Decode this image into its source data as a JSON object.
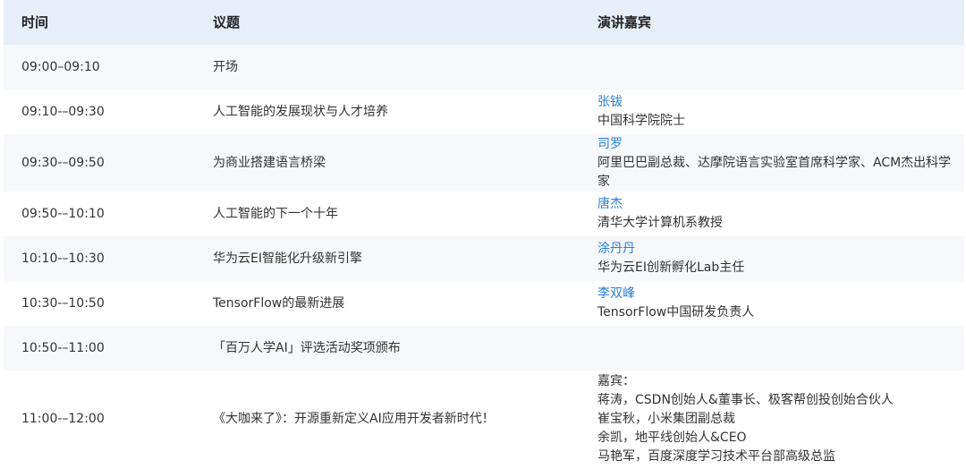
{
  "table": {
    "headers": {
      "time": "时间",
      "topic": "议题",
      "speaker": "演讲嘉宾"
    },
    "rows": [
      {
        "time": "09:00–09:10",
        "topic": "开场",
        "speaker_name": "",
        "speaker_lines": []
      },
      {
        "time": "09:10-–09:30",
        "topic": "人工智能的发展现状与人才培养",
        "speaker_name": "张钹",
        "speaker_lines": [
          "中国科学院院士"
        ]
      },
      {
        "time": "09:30-–09:50",
        "topic": "为商业搭建语言桥梁",
        "speaker_name": "司罗",
        "speaker_lines": [
          "阿里巴巴副总裁、达摩院语言实验室首席科学家、ACM杰出科学",
          "家"
        ]
      },
      {
        "time": "09:50-–10:10",
        "topic": "人工智能的下一个十年",
        "speaker_name": "唐杰",
        "speaker_lines": [
          "清华大学计算机系教授"
        ]
      },
      {
        "time": "10:10-–10:30",
        "topic": "华为云EI智能化升级新引擎",
        "speaker_name": "涂丹丹",
        "speaker_lines": [
          "华为云EI创新孵化Lab主任"
        ]
      },
      {
        "time": "10:30-–10:50",
        "topic": "TensorFlow的最新进展",
        "speaker_name": "李双峰",
        "speaker_lines": [
          "TensorFlow中国研发负责人"
        ]
      },
      {
        "time": "10:50-–11:00",
        "topic": "「百万人学AI」评选活动奖项颁布",
        "speaker_name": "",
        "speaker_lines": []
      },
      {
        "time": "11:00-–12:00",
        "topic": "《大咖来了》：开源重新定义AI应用开发者新时代！",
        "speaker_name": "",
        "speaker_lines": [
          "嘉宾：",
          "蒋涛，CSDN创始人&董事长、极客帮创投创始合伙人",
          "崔宝秋，小米集团副总裁",
          "余凯，地平线创始人&CEO",
          "马艳军，百度深度学习技术平台部高级总监"
        ]
      }
    ]
  }
}
